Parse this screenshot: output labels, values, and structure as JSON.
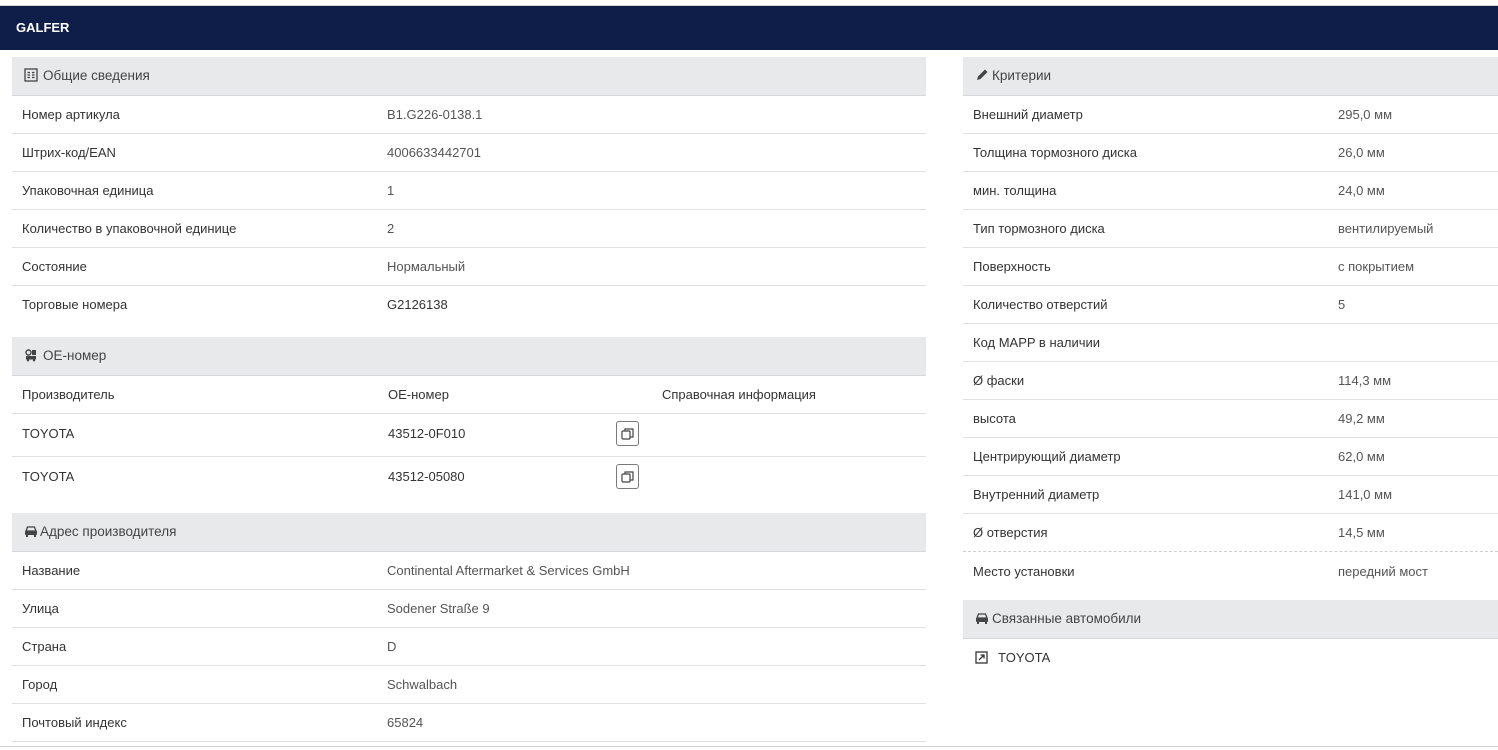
{
  "header": {
    "brand": "GALFER"
  },
  "general": {
    "title": "Общие сведения",
    "rows": [
      {
        "label": "Номер артикула",
        "value": "B1.G226-0138.1"
      },
      {
        "label": "Штрих-код/EAN",
        "value": "4006633442701"
      },
      {
        "label": "Упаковочная единица",
        "value": "1"
      },
      {
        "label": "Количество в упаковочной единице",
        "value": "2"
      },
      {
        "label": "Состояние",
        "value": "Нормальный"
      },
      {
        "label": "Торговые номера",
        "value": "G2126138"
      }
    ]
  },
  "oe": {
    "title": "OE-номер",
    "columns": [
      "Производитель",
      "OE-номер",
      "Справочная информация"
    ],
    "rows": [
      {
        "maker": "TOYOTA",
        "number": "43512-0F010"
      },
      {
        "maker": "TOYOTA",
        "number": "43512-05080"
      }
    ]
  },
  "address": {
    "title": "Адрес производителя",
    "rows": [
      {
        "label": "Название",
        "value": "Continental Aftermarket & Services GmbH"
      },
      {
        "label": "Улица",
        "value": "Sodener Straße 9"
      },
      {
        "label": "Страна",
        "value": "D"
      },
      {
        "label": "Город",
        "value": "Schwalbach"
      },
      {
        "label": "Почтовый индекс",
        "value": "65824"
      }
    ]
  },
  "criteria": {
    "title": "Критерии",
    "rows": [
      {
        "label": "Внешний диаметр",
        "value": "295,0 мм"
      },
      {
        "label": "Толщина тормозного диска",
        "value": "26,0 мм"
      },
      {
        "label": "мин. толщина",
        "value": "24,0 мм"
      },
      {
        "label": "Тип тормозного диска",
        "value": "вентилируемый"
      },
      {
        "label": "Поверхность",
        "value": "с покрытием"
      },
      {
        "label": "Количество отверстий",
        "value": "5"
      },
      {
        "label": "Код MAPP в наличии",
        "value": ""
      },
      {
        "label": "Ø фаски",
        "value": "114,3 мм"
      },
      {
        "label": "высота",
        "value": "49,2 мм"
      },
      {
        "label": "Центрирующий диаметр",
        "value": "62,0 мм"
      },
      {
        "label": "Внутренний диаметр",
        "value": "141,0 мм"
      },
      {
        "label": "Ø отверстия",
        "value": "14,5 мм"
      },
      {
        "label": "Место установки",
        "value": "передний мост"
      }
    ]
  },
  "vehicles": {
    "title": "Связанные автомобили",
    "items": [
      "TOYOTA"
    ]
  }
}
